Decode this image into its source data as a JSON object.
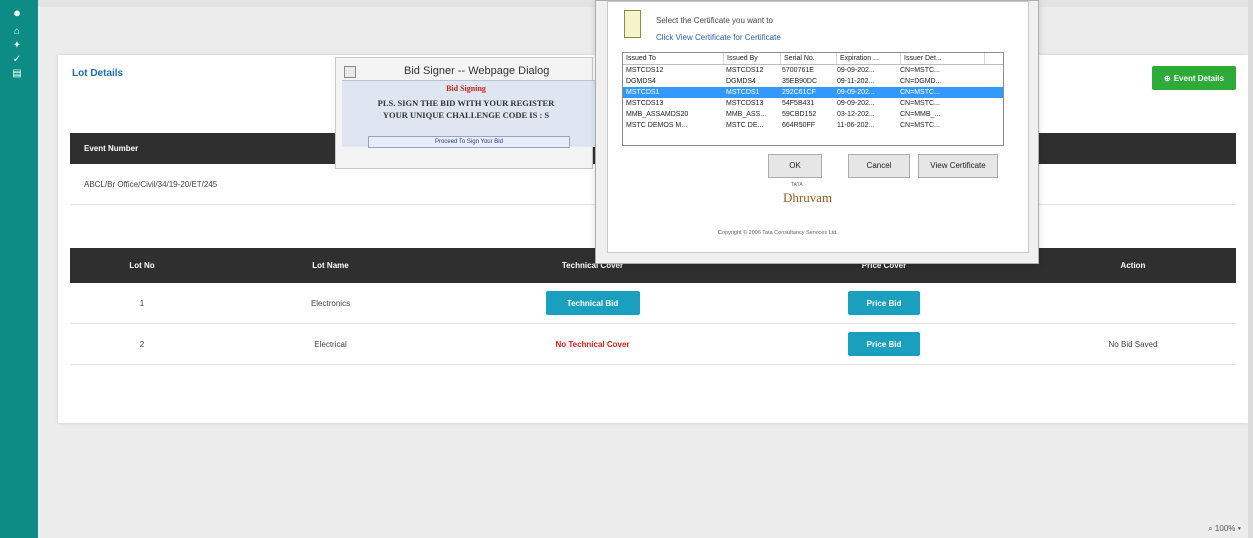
{
  "sidebar": {
    "icons": [
      "user-icon",
      "home-icon",
      "gavel-icon",
      "check-icon",
      "chart-icon"
    ]
  },
  "page": {
    "lot_details_title": "Lot Details",
    "event_details_button": "Event Details",
    "event_number_header": "Event Number",
    "event_number_value": "ABCL/Br Office/Civil/34/19-20/ET/245",
    "lots_table": {
      "headers": [
        "Lot No",
        "Lot Name",
        "Technical Cover",
        "Price Cover",
        "Action"
      ],
      "rows": [
        {
          "lot_no": "1",
          "lot_name": "Electronics",
          "technical": "Technical Bid",
          "price": "Price Bid",
          "action": ""
        },
        {
          "lot_no": "2",
          "lot_name": "Electrical",
          "technical": "No Technical Cover",
          "price": "Price Bid",
          "action": "No Bid Saved"
        }
      ]
    }
  },
  "bid_signer": {
    "title": "Bid Signer -- Webpage Dialog",
    "heading": "Bid Signing",
    "line1": "PLS. SIGN THE BID WITH YOUR REGISTER",
    "line2": "YOUR UNIQUE CHALLENGE CODE IS : S",
    "button": "Proceed To Sign Your Bid"
  },
  "cert_dialog": {
    "line1": "Select the Certificate you want to",
    "line2": "Click View Certificate for Certificate",
    "columns": [
      "Issued To",
      "Issued By",
      "Serial No.",
      "Expiration ...",
      "Issuer Det..."
    ],
    "rows": [
      [
        "MSTCDS12",
        "MSTCDS12",
        "5700761E",
        "09-09-202...",
        "CN=MSTC..."
      ],
      [
        "DGMDS4",
        "DGMDS4",
        "35EB90DC",
        "09-11-202...",
        "CN=DGMD..."
      ],
      [
        "MSTCDS1",
        "MSTCDS1",
        "292C61CF",
        "09-09-202...",
        "CN=MSTC..."
      ],
      [
        "MSTCDS13",
        "MSTCDS13",
        "54F5B431",
        "09-09-202...",
        "CN=MSTC..."
      ],
      [
        "MMB_ASSAMDS20",
        "MMB_ASS...",
        "59CBD152",
        "03-12-202...",
        "CN=MMB_..."
      ],
      [
        "MSTC DEMOS M...",
        "MSTC DE...",
        "664R50FF",
        "11-06-202...",
        "CN=MSTC..."
      ]
    ],
    "selected_row": 2,
    "ok": "OK",
    "cancel": "Cancel",
    "view": "View Certificate",
    "brand_small": "TATA",
    "brand": "Dhruvam",
    "copyright": "Copyright © 2006 Tata Consultancy Services Ltd."
  },
  "status": {
    "zoom": "100%"
  },
  "colors": {
    "sidebar": "#0c8c84",
    "event_button": "#2daa38",
    "table_button": "#1b9fbf",
    "no_cover": "#e02020"
  }
}
